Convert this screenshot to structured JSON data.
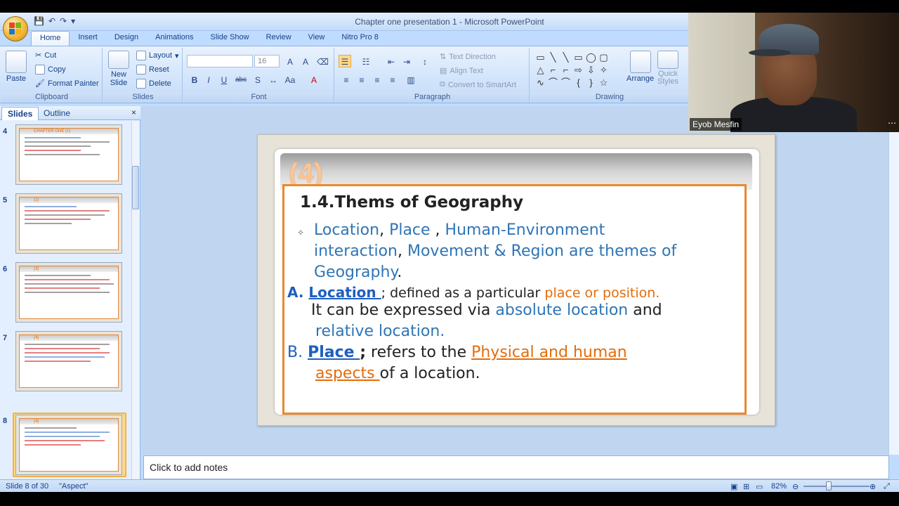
{
  "window": {
    "title": "Chapter one presentation 1 - Microsoft PowerPoint"
  },
  "tabs": [
    "Home",
    "Insert",
    "Design",
    "Animations",
    "Slide Show",
    "Review",
    "View",
    "Nitro Pro 8"
  ],
  "ribbon": {
    "clipboard": {
      "label": "Clipboard",
      "paste": "Paste",
      "cut": "Cut",
      "copy": "Copy",
      "format_painter": "Format Painter"
    },
    "slides": {
      "label": "Slides",
      "new_slide": "New",
      "new_slide2": "Slide",
      "layout": "Layout",
      "reset": "Reset",
      "delete": "Delete"
    },
    "font": {
      "label": "Font",
      "font_size": "16"
    },
    "paragraph": {
      "label": "Paragraph",
      "text_direction": "Text Direction",
      "align_text": "Align Text",
      "convert_smartart": "Convert to SmartArt"
    },
    "drawing": {
      "label": "Drawing",
      "arrange": "Arrange",
      "quick_styles": "Quick",
      "quick_styles2": "Styles"
    }
  },
  "left_panel": {
    "tab_slides": "Slides",
    "tab_outline": "Outline",
    "close": "×",
    "thumbnails": [
      {
        "num": "4",
        "title": "CHAPTER ONE   (1)"
      },
      {
        "num": "5",
        "title": "(2)"
      },
      {
        "num": "6",
        "title": "(3)"
      },
      {
        "num": "7",
        "title": "(4)"
      },
      {
        "num": "8",
        "title": "(4)"
      }
    ]
  },
  "slide": {
    "number_label": "(4)",
    "title": "1.4.Thems of Geography",
    "bullet_1": {
      "location": "Location",
      "place": "Place",
      "comma1": ", ",
      "comma2": " , ",
      "hei": "Human-Environment",
      "interaction": "interaction",
      "comma3": ", ",
      "movement": "Movement & Region are themes of",
      "geography": "Geography",
      "period": "."
    },
    "a": {
      "marker": "A. ",
      "term": "Location ",
      "def": "; defined as a particular ",
      "highlight": "place or position.",
      "l2a": "It can be expressed via ",
      "l2b": "absolute location",
      "l2c": " and",
      "l3": "relative location."
    },
    "b": {
      "marker": "B. ",
      "term": "Place ",
      "semi": ";",
      "def": " refers to the ",
      "highlight1": "Physical and human",
      "highlight2": "aspects ",
      "rest": "of a location."
    }
  },
  "notes": {
    "placeholder": "Click to add notes"
  },
  "status": {
    "slide_of": "Slide 8 of 30",
    "theme": "\"Aspect\"",
    "zoom": "82%"
  },
  "webcam": {
    "name": "Eyob Mesfin"
  }
}
